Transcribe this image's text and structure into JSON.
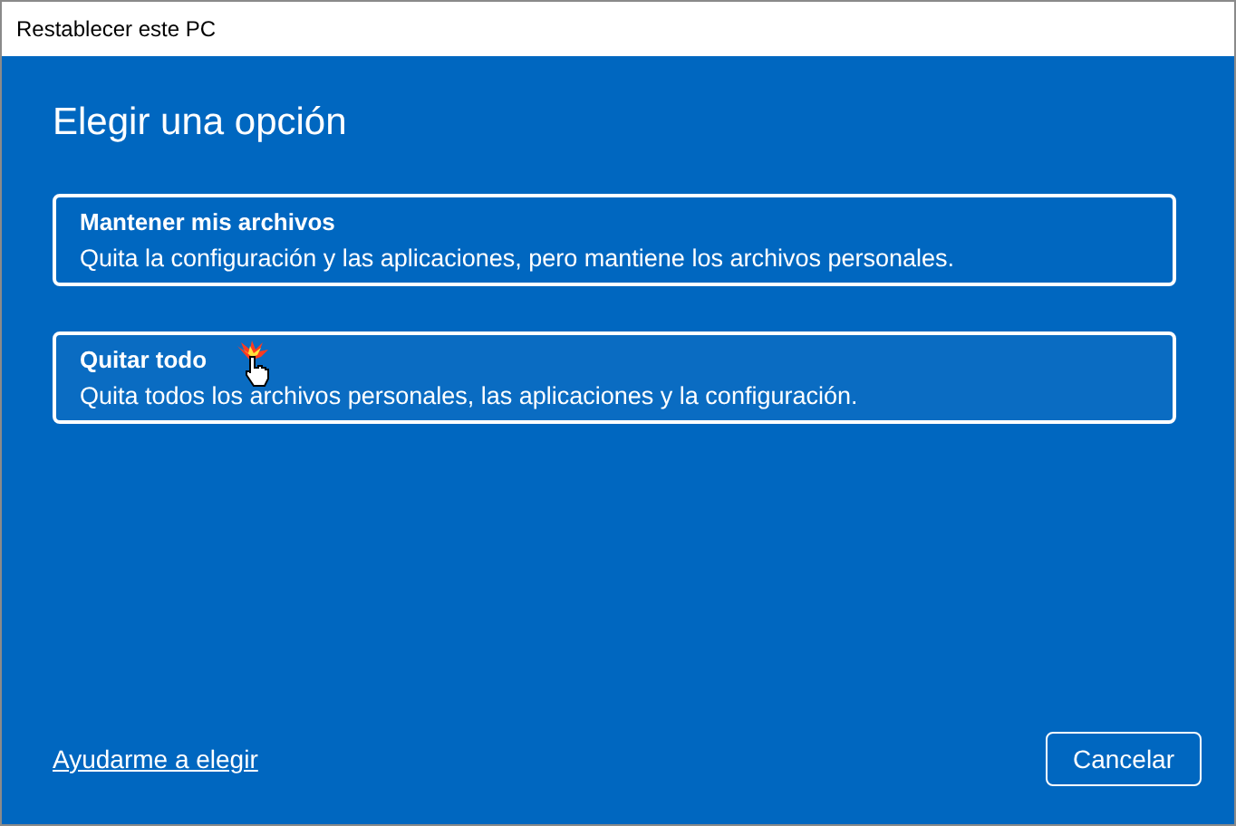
{
  "window": {
    "title": "Restablecer este PC"
  },
  "heading": "Elegir una opción",
  "options": [
    {
      "title": "Mantener mis archivos",
      "description": "Quita la configuración y las aplicaciones, pero mantiene los archivos personales.",
      "hovered": false
    },
    {
      "title": "Quitar todo",
      "description": "Quita todos los archivos personales, las aplicaciones y la configuración.",
      "hovered": true
    }
  ],
  "help_link": "Ayudarme a elegir",
  "buttons": [
    "Cancelar"
  ]
}
